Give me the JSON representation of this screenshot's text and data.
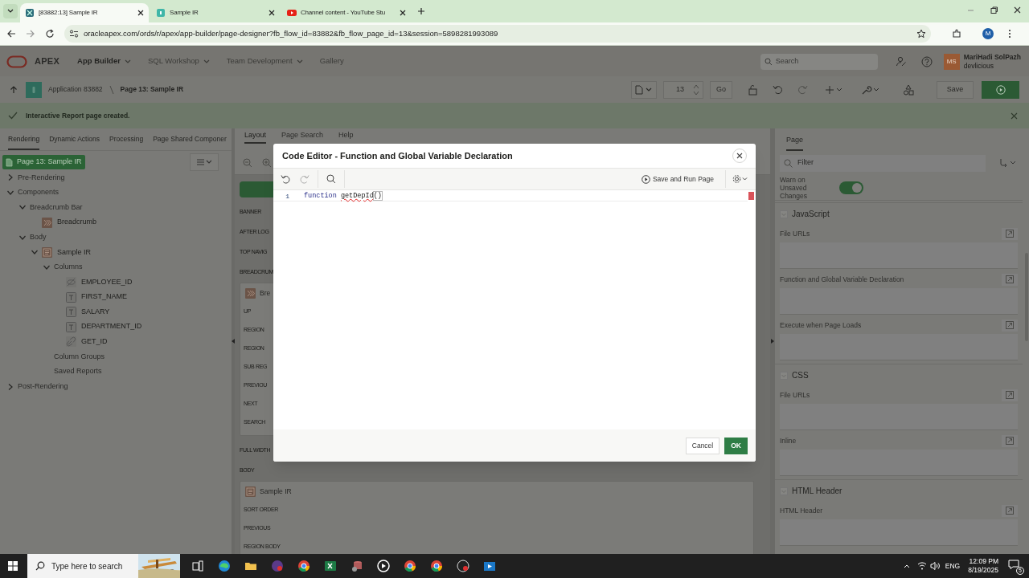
{
  "browser": {
    "tabs": [
      {
        "title": "[83882:13] Sample IR",
        "selected": true,
        "kind": "apex"
      },
      {
        "title": "Sample IR",
        "selected": false,
        "kind": "app"
      },
      {
        "title": "Channel content - YouTube Stu",
        "selected": false,
        "kind": "video"
      }
    ],
    "url": "oracleapex.com/ords/r/apex/app-builder/page-designer?fb_flow_id=83882&fb_flow_page_id=13&session=5898281993089",
    "profile_initial": "M"
  },
  "header": {
    "product": "APEX",
    "menus": [
      {
        "label": "App Builder",
        "selected": true,
        "dropdown": true
      },
      {
        "label": "SQL Workshop",
        "selected": false,
        "dropdown": true
      },
      {
        "label": "Team Development",
        "selected": false,
        "dropdown": true
      },
      {
        "label": "Gallery",
        "selected": false,
        "dropdown": false
      }
    ],
    "search_placeholder": "Search",
    "user": {
      "initials": "MS",
      "name": "MariHadi SolPazh",
      "workspace": "devlicious"
    }
  },
  "toolbar": {
    "application": "Application 83882",
    "page": "Page 13: Sample IR",
    "page_number": "13",
    "go": "Go",
    "save": "Save"
  },
  "message": "Interactive Report page created.",
  "left_panel": {
    "tabs": [
      {
        "label": "Rendering",
        "selected": true
      },
      {
        "label": "Dynamic Actions",
        "selected": false
      },
      {
        "label": "Processing",
        "selected": false
      },
      {
        "label": "Page Shared Componer",
        "selected": false
      }
    ],
    "tree": {
      "root": "Page 13: Sample IR",
      "items": [
        {
          "label": "Pre-Rendering",
          "expanded": false
        },
        {
          "label": "Components",
          "expanded": true,
          "children": [
            {
              "label": "Breadcrumb Bar",
              "expanded": true,
              "children": [
                {
                  "label": "Breadcrumb",
                  "kind": "breadcrumb"
                }
              ]
            },
            {
              "label": "Body",
              "expanded": true,
              "children": [
                {
                  "label": "Sample IR",
                  "kind": "report",
                  "expanded": true,
                  "children": [
                    {
                      "label": "Columns",
                      "expanded": true,
                      "children": [
                        {
                          "label": "EMPLOYEE_ID",
                          "kind": "hidden"
                        },
                        {
                          "label": "FIRST_NAME",
                          "kind": "text"
                        },
                        {
                          "label": "SALARY",
                          "kind": "text"
                        },
                        {
                          "label": "DEPARTMENT_ID",
                          "kind": "text"
                        },
                        {
                          "label": "GET_ID",
                          "kind": "link"
                        }
                      ]
                    },
                    {
                      "label": "Column Groups"
                    },
                    {
                      "label": "Saved Reports"
                    }
                  ]
                }
              ]
            }
          ]
        },
        {
          "label": "Post-Rendering",
          "expanded": false
        }
      ]
    }
  },
  "layout": {
    "tabs": [
      {
        "label": "Layout",
        "selected": true
      },
      {
        "label": "Page Search",
        "selected": false
      },
      {
        "label": "Help",
        "selected": false
      }
    ],
    "positions": [
      {
        "label": "BANNER"
      },
      {
        "label": "AFTER LOG"
      },
      {
        "label": "TOP NAVIG"
      },
      {
        "label": "BREADCRUM",
        "region": {
          "title": "Bre",
          "kind": "breadcrumb",
          "slots": [
            "UP",
            "REGION",
            "REGION",
            "SUB REG",
            "PREVIOU",
            "NEXT",
            "SEARCH"
          ]
        }
      },
      {
        "label": "FULL WIDTH"
      },
      {
        "label": "BODY",
        "region": {
          "title": "Sample IR",
          "kind": "report",
          "slots": [
            "SORT ORDER",
            "PREVIOUS",
            "REGION BODY"
          ]
        }
      }
    ]
  },
  "property_editor": {
    "tabs": [
      {
        "label": "Page",
        "selected": true
      }
    ],
    "filter_placeholder": "Filter",
    "warn": {
      "label": "Warn on Unsaved Changes",
      "on": true
    },
    "groups": [
      {
        "title": "JavaScript",
        "fields": [
          "File URLs",
          "Function and Global Variable Declaration",
          "Execute when Page Loads"
        ]
      },
      {
        "title": "CSS",
        "fields": [
          "File URLs",
          "Inline"
        ]
      },
      {
        "title": "HTML Header",
        "fields": [
          "HTML Header"
        ]
      }
    ]
  },
  "dialog": {
    "title": "Code Editor - Function and Global Variable Declaration",
    "save_run": "Save and Run Page",
    "lines": [
      {
        "number": "1",
        "tokens": [
          {
            "text": "function",
            "kind": "keyword"
          },
          {
            "text": "getDepId",
            "kind": "error"
          },
          {
            "text": "()",
            "kind": "bracket"
          }
        ]
      }
    ],
    "error_marker": true,
    "cancel": "Cancel",
    "ok": "OK"
  },
  "taskbar": {
    "search_placeholder": "Type here to search",
    "language": "ENG",
    "time": "12:09 PM",
    "date": "8/19/2025",
    "notifications": "5"
  }
}
